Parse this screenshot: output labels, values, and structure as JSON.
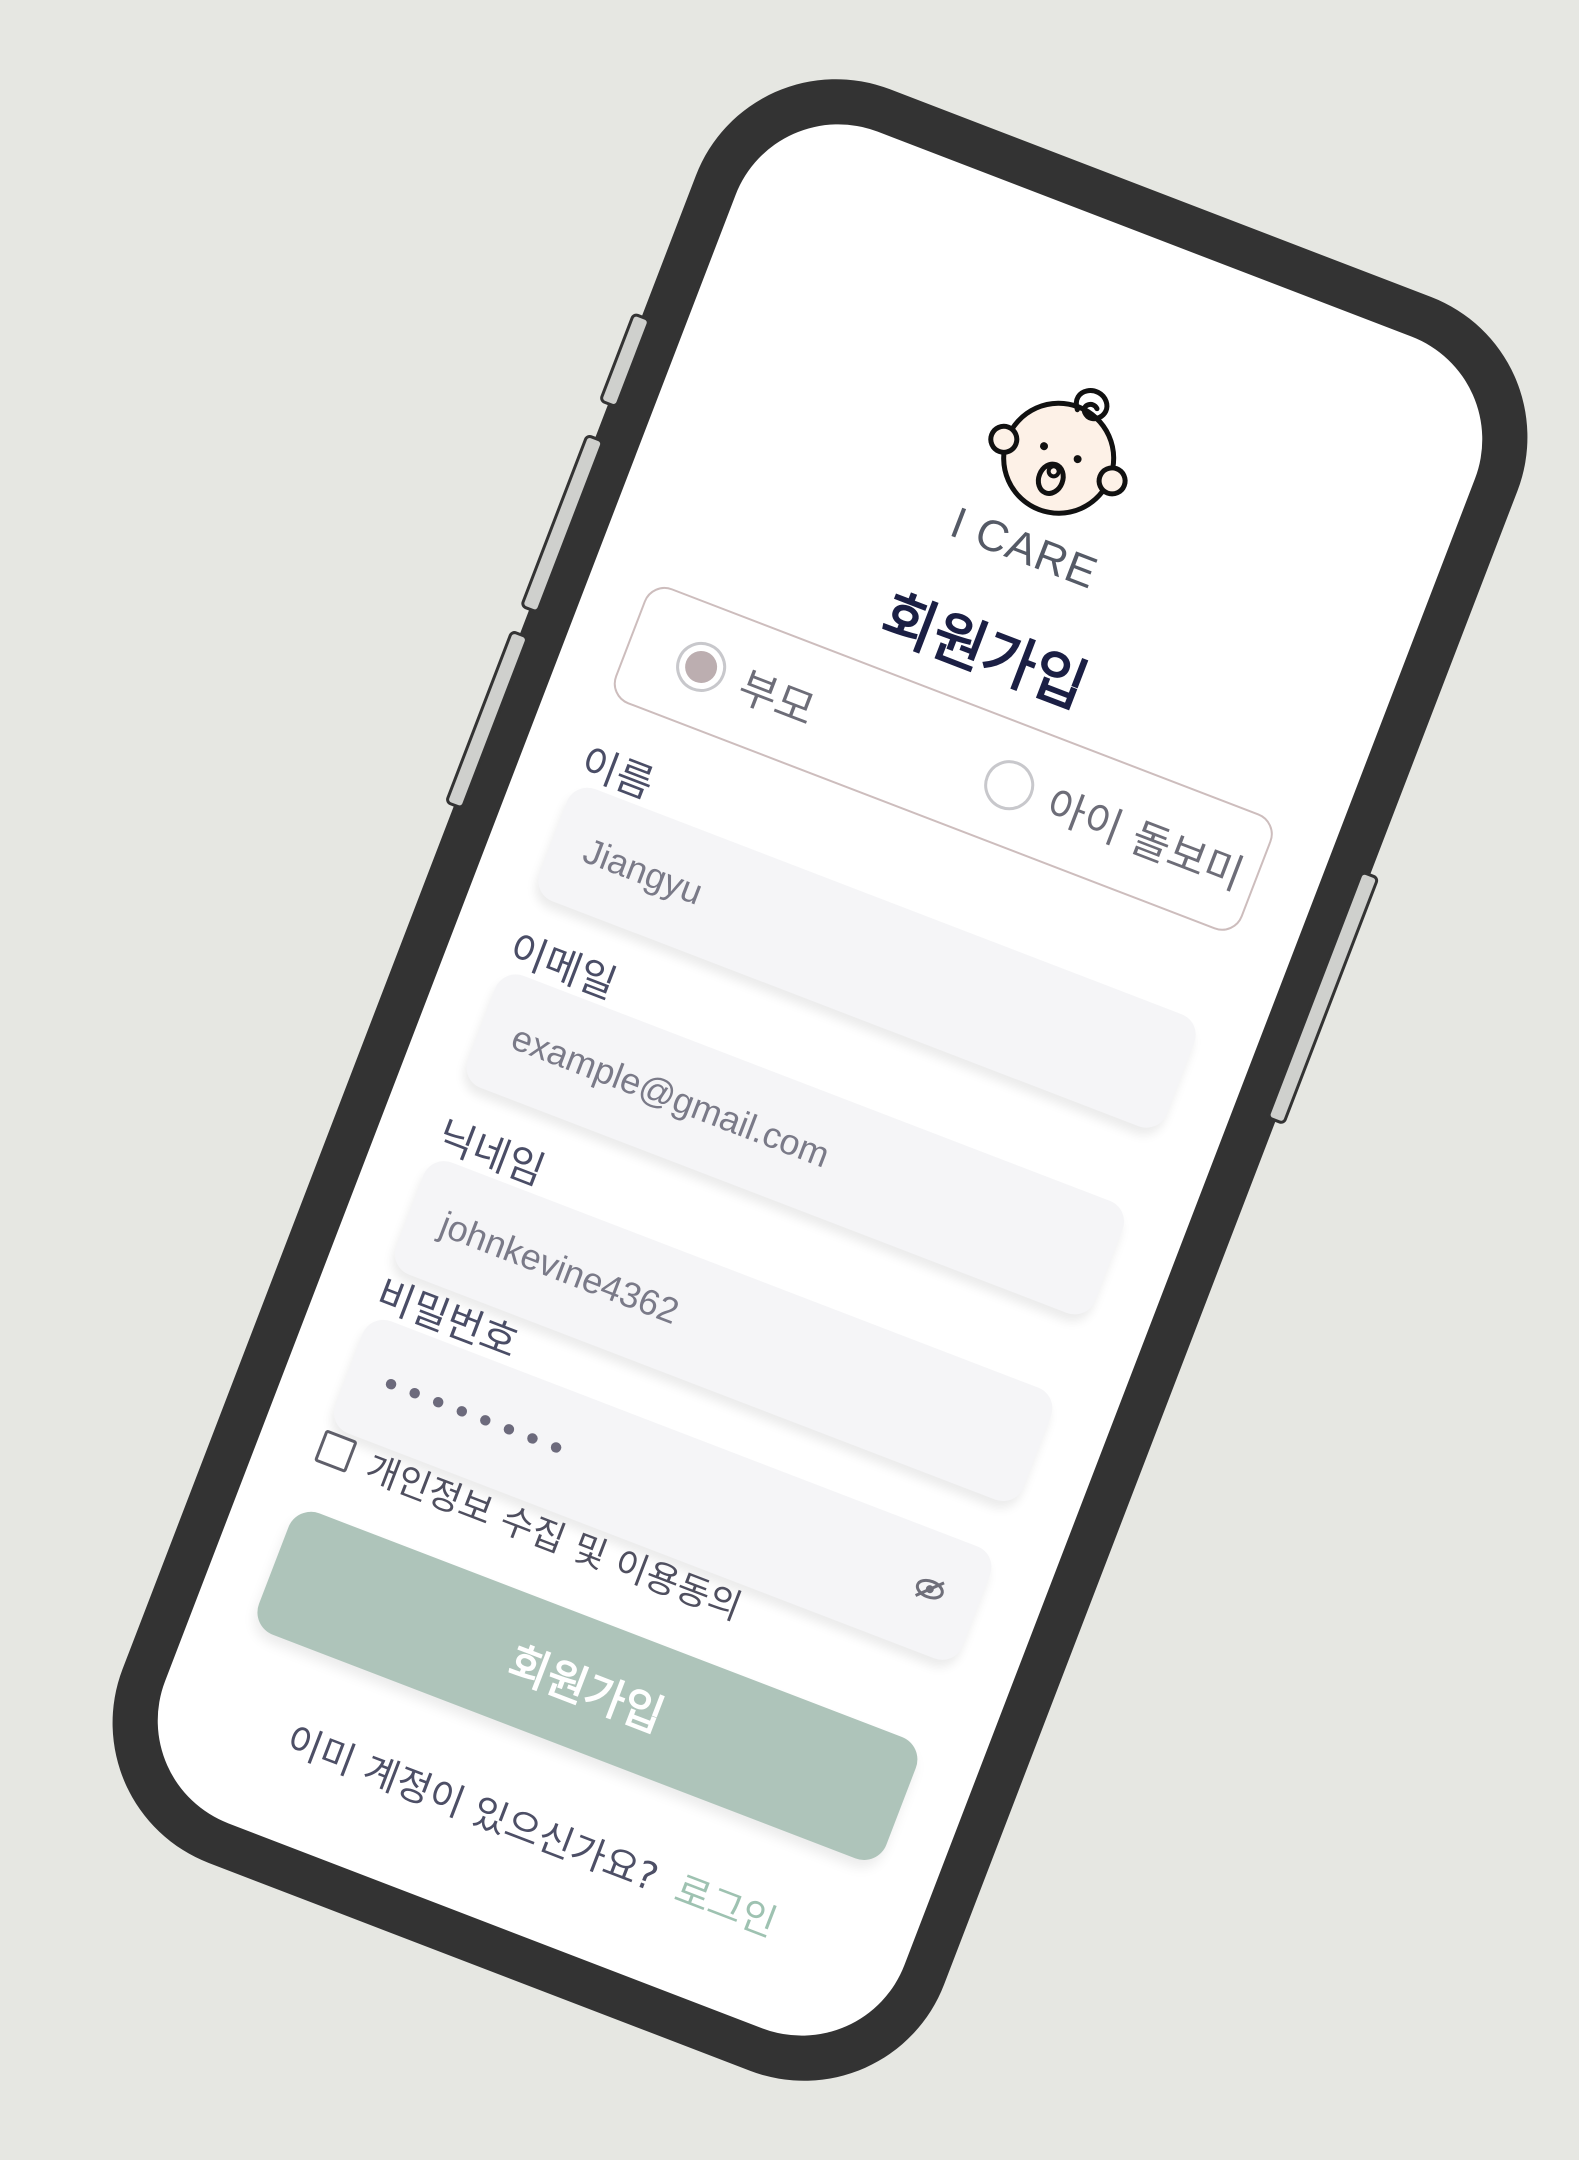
{
  "app": {
    "brand": "I CARE",
    "title": "회원가입"
  },
  "role": {
    "options": [
      {
        "label": "부모",
        "selected": true
      },
      {
        "label": "아이 돌보미",
        "selected": false
      }
    ]
  },
  "form": {
    "name_label": "이름",
    "name_value": "Jiangyu",
    "email_label": "이메일",
    "email_value": "example@gmail.com",
    "nickname_label": "닉네임",
    "nickname_value": "johnkevine4362",
    "password_label": "비밀번호",
    "password_value": "••••••••"
  },
  "consent": {
    "label": "개인정보 수집 및 이용동의",
    "checked": false
  },
  "submit_label": "회원가입",
  "footer": {
    "text": "이미 계정이 있으신가요?",
    "link": "로그인"
  },
  "colors": {
    "background": "#e6e7e2",
    "phone_frame": "#333333",
    "title": "#1b1f44",
    "button": "#aec4ba",
    "link": "#9ec2b1",
    "field": "#f5f5f7"
  },
  "icons": {
    "logo": "baby-face-icon",
    "password_toggle": "eye-slash-icon"
  }
}
